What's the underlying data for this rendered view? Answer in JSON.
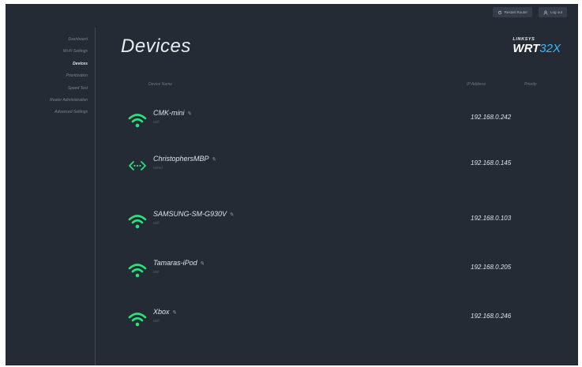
{
  "topbar": {
    "restart_label": "Restart Router",
    "logout_label": "Log out"
  },
  "sidebar": {
    "items": [
      {
        "label": "Dashboard",
        "active": false
      },
      {
        "label": "Wi-Fi Settings",
        "active": false
      },
      {
        "label": "Devices",
        "active": true
      },
      {
        "label": "Prioritization",
        "active": false
      },
      {
        "label": "Speed Test",
        "active": false
      },
      {
        "label": "Router Administration",
        "active": false
      },
      {
        "label": "Advanced Settings",
        "active": false
      }
    ]
  },
  "page": {
    "title": "Devices"
  },
  "logo": {
    "top": "LINKSYS",
    "main": "WRT",
    "accent": "32X"
  },
  "table": {
    "headers": {
      "name": "Device Name",
      "ip": "IP Address",
      "priority": "Priority"
    },
    "rows": [
      {
        "name": "CMK-mini",
        "connection": "Wifi",
        "icon": "wifi-icon",
        "ip": "192.168.0.242"
      },
      {
        "name": "ChristophersMBP",
        "connection": "Wired",
        "icon": "wired-icon",
        "ip": "192.168.0.145"
      },
      {
        "name": "SAMSUNG-SM-G930V",
        "connection": "Wifi",
        "icon": "wifi-icon",
        "ip": "192.168.0.103"
      },
      {
        "name": "Tamaras-iPod",
        "connection": "Wifi",
        "icon": "wifi-icon",
        "ip": "192.168.0.205"
      },
      {
        "name": "Xbox",
        "connection": "Wifi",
        "icon": "wifi-icon",
        "ip": "192.168.0.246"
      }
    ]
  },
  "colors": {
    "background": "#242b35",
    "accent_green": "#2ee07a",
    "accent_blue": "#3ab7ff"
  }
}
